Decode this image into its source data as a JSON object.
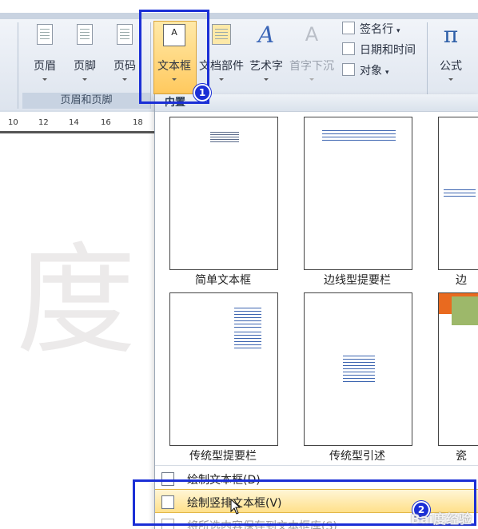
{
  "ribbon": {
    "header_footer_group": {
      "buttons": [
        {
          "label": "页眉",
          "icon": "page-header-icon"
        },
        {
          "label": "页脚",
          "icon": "page-footer-icon"
        },
        {
          "label": "页码",
          "icon": "page-number-icon"
        }
      ],
      "group_label": "页眉和页脚"
    },
    "text_group": {
      "buttons": [
        {
          "label": "文本框",
          "icon": "textbox-icon"
        },
        {
          "label": "文档部件",
          "icon": "quick-parts-icon"
        },
        {
          "label": "艺术字",
          "icon": "wordart-icon"
        },
        {
          "label": "首字下沉",
          "icon": "drop-cap-icon",
          "disabled": true
        }
      ],
      "small_items": [
        {
          "label": "签名行",
          "icon": "signature-line-icon"
        },
        {
          "label": "日期和时间",
          "icon": "date-time-icon"
        },
        {
          "label": "对象",
          "icon": "object-icon"
        }
      ]
    },
    "symbols_group": {
      "buttons": [
        {
          "label": "公式",
          "icon": "equation-pi-icon"
        }
      ]
    }
  },
  "ruler": {
    "ticks": [
      "10",
      "12",
      "14",
      "16",
      "18"
    ]
  },
  "document": {
    "watermark": "度"
  },
  "dropdown": {
    "header": "内置",
    "gallery": [
      {
        "caption": "简单文本框"
      },
      {
        "caption": "边线型提要栏"
      },
      {
        "caption": "边"
      },
      {
        "caption": "传统型提要栏"
      },
      {
        "caption": "传统型引述"
      },
      {
        "caption": "瓷"
      }
    ],
    "menu": [
      {
        "label": "绘制文本框(D)",
        "icon": "draw-textbox-icon"
      },
      {
        "label": "绘制竖排文本框(V)",
        "icon": "draw-vertical-textbox-icon"
      },
      {
        "label": "将所选内容保存到文本框库(S)",
        "icon": "save-selection-icon"
      }
    ]
  },
  "annotations": {
    "badge1": "1",
    "badge2": "2",
    "color": "#1b2fd6"
  },
  "watermark_logo": "Bai度经验"
}
